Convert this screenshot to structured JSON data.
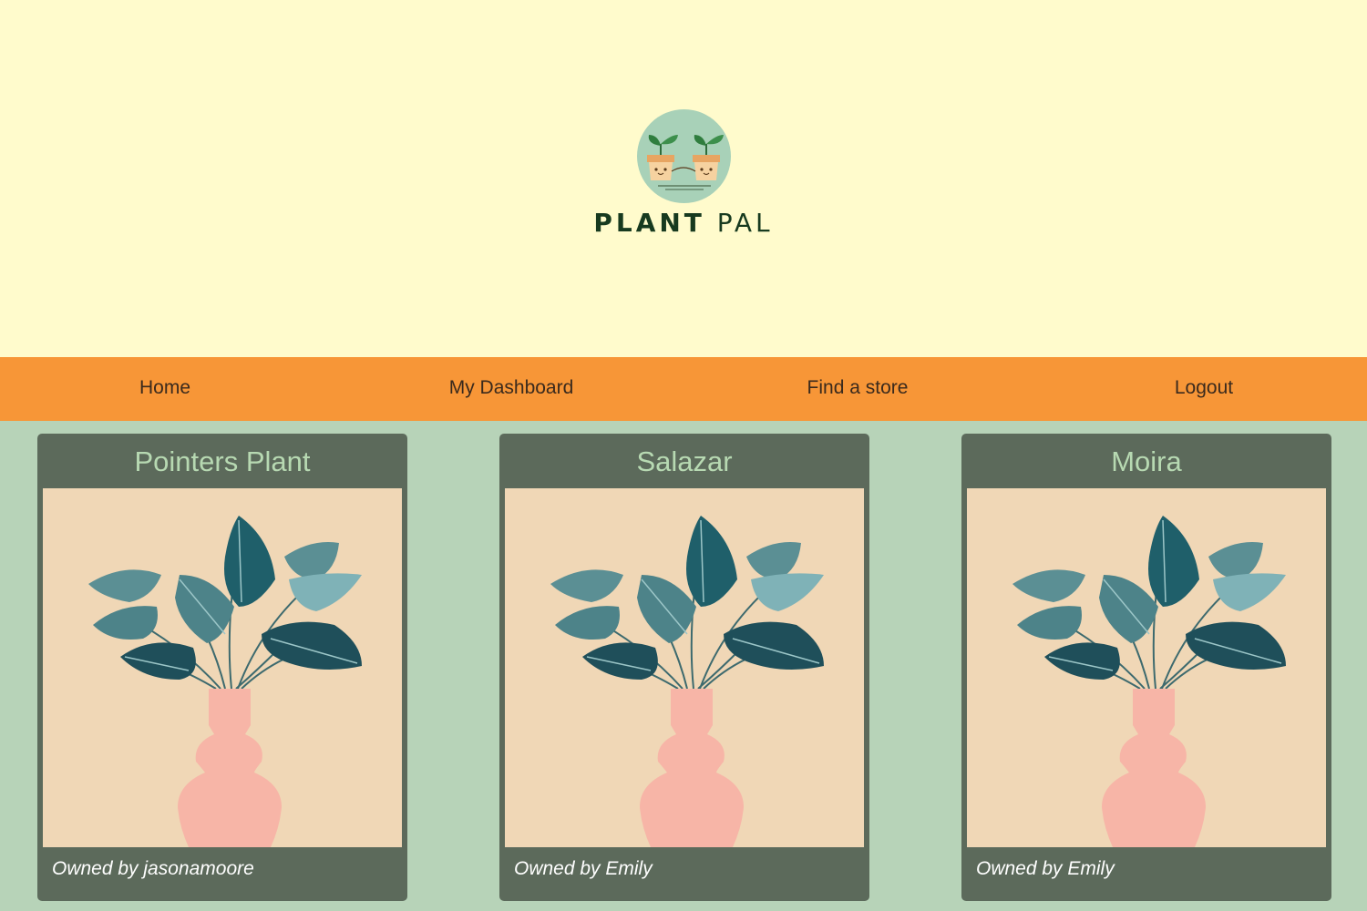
{
  "brand": {
    "name_bold": "PLANT",
    "name_light": " PAL"
  },
  "nav": {
    "home": "Home",
    "dashboard": "My Dashboard",
    "find_store": "Find a store",
    "logout": "Logout"
  },
  "plants": [
    {
      "name": "Pointers Plant",
      "owner": "Owned by jasonamoore"
    },
    {
      "name": "Salazar",
      "owner": "Owned by Emily"
    },
    {
      "name": "Moira",
      "owner": "Owned by Emily"
    }
  ],
  "colors": {
    "header_bg": "#fffbcc",
    "nav_bg": "#f79637",
    "page_bg": "#b7d3b8",
    "card_bg": "#5c6a5b",
    "card_title": "#b7d9b2",
    "image_bg": "#f0d7b6",
    "vase": "#f7b5a7"
  },
  "icons": {
    "logo": "plant-pots-logo-icon",
    "plant_image": "plant-in-vase-illustration"
  }
}
